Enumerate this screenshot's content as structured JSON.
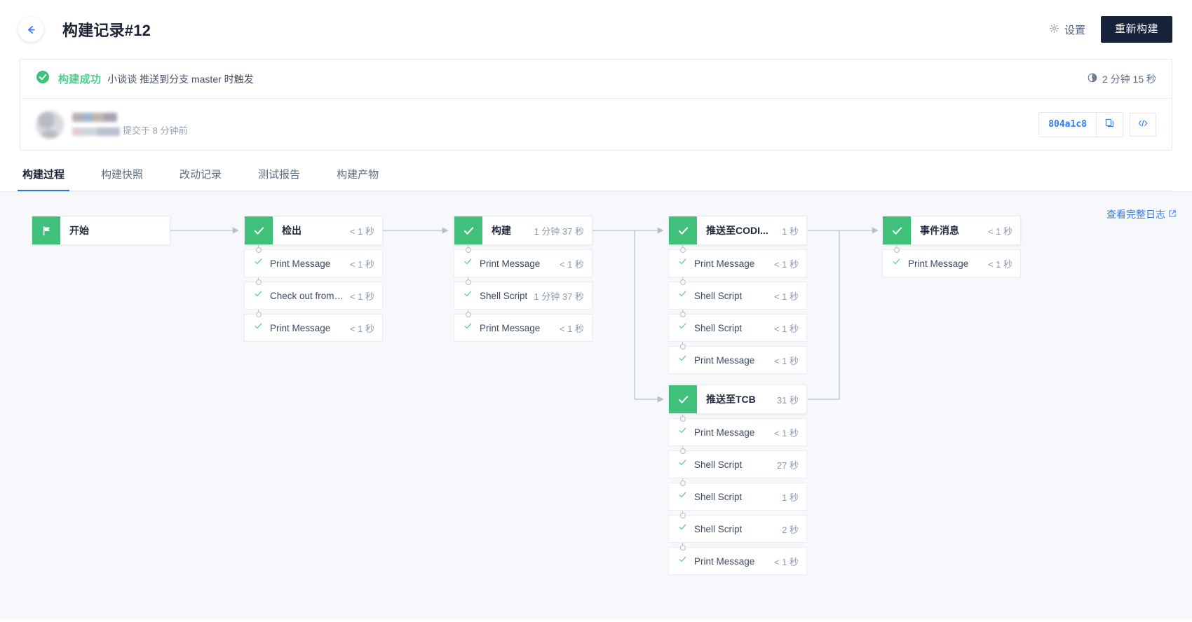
{
  "header": {
    "back_icon": "arrow-left-icon",
    "title": "构建记录#12",
    "settings_label": "设置",
    "settings_icon": "gear-icon",
    "rebuild_label": "重新构建"
  },
  "summary": {
    "status_icon": "check-circle-icon",
    "status_text": "构建成功",
    "trigger_text": "小谈谈 推送到分支 master 时触发",
    "duration_icon": "clock-icon",
    "duration": "2 分钟 15 秒",
    "commit_time": "提交于 8 分钟前",
    "commit_hash": "804a1c8",
    "copy_icon": "copy-icon",
    "code_icon": "code-brackets-icon"
  },
  "tabs": [
    {
      "label": "构建过程",
      "active": true
    },
    {
      "label": "构建快照",
      "active": false
    },
    {
      "label": "改动记录",
      "active": false
    },
    {
      "label": "测试报告",
      "active": false
    },
    {
      "label": "构建产物",
      "active": false
    }
  ],
  "canvas": {
    "full_log_label": "查看完整日志",
    "full_log_icon": "external-link-icon"
  },
  "colors": {
    "accent_blue": "#2f7bf5",
    "success_green": "#3fc07b",
    "status_green": "#4ecb8d",
    "dark_button": "#17233b",
    "canvas_bg": "#f6f8fb",
    "wire": "#b7c1ce"
  },
  "pipeline": {
    "stages": [
      {
        "id": "start",
        "name": "开始",
        "time": "",
        "icon": "flag-icon",
        "steps": []
      },
      {
        "id": "checkout",
        "name": "检出",
        "time": "< 1 秒",
        "icon": "check-icon",
        "steps": [
          {
            "name": "Print Message",
            "time": "< 1 秒"
          },
          {
            "name": "Check out from v...",
            "time": "< 1 秒"
          },
          {
            "name": "Print Message",
            "time": "< 1 秒"
          }
        ]
      },
      {
        "id": "build",
        "name": "构建",
        "time": "1 分钟 37 秒",
        "icon": "check-icon",
        "steps": [
          {
            "name": "Print Message",
            "time": "< 1 秒"
          },
          {
            "name": "Shell Script",
            "time": "1 分钟 37 秒"
          },
          {
            "name": "Print Message",
            "time": "< 1 秒"
          }
        ]
      },
      {
        "id": "push-coding",
        "name": "推送至CODI...",
        "time": "1 秒",
        "icon": "check-icon",
        "steps": [
          {
            "name": "Print Message",
            "time": "< 1 秒"
          },
          {
            "name": "Shell Script",
            "time": "< 1 秒"
          },
          {
            "name": "Shell Script",
            "time": "< 1 秒"
          },
          {
            "name": "Print Message",
            "time": "< 1 秒"
          }
        ]
      },
      {
        "id": "push-tcb",
        "name": "推送至TCB",
        "time": "31 秒",
        "icon": "check-icon",
        "steps": [
          {
            "name": "Print Message",
            "time": "< 1 秒"
          },
          {
            "name": "Shell Script",
            "time": "27 秒"
          },
          {
            "name": "Shell Script",
            "time": "1 秒"
          },
          {
            "name": "Shell Script",
            "time": "2 秒"
          },
          {
            "name": "Print Message",
            "time": "< 1 秒"
          }
        ]
      },
      {
        "id": "event-message",
        "name": "事件消息",
        "time": "< 1 秒",
        "icon": "check-icon",
        "steps": [
          {
            "name": "Print Message",
            "time": "< 1 秒"
          }
        ]
      }
    ]
  }
}
